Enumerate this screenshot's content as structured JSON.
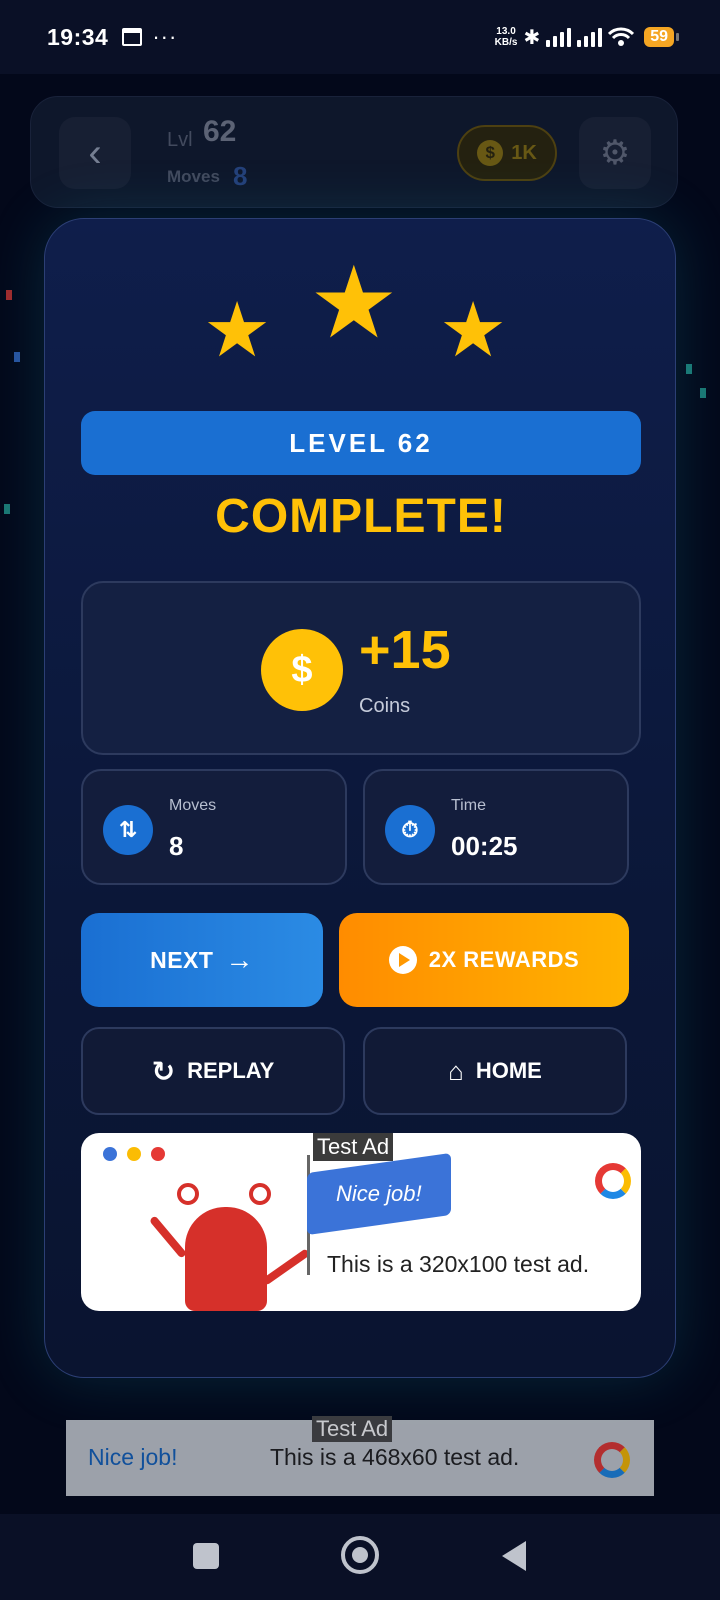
{
  "status_bar": {
    "time": "19:34",
    "more": "···",
    "net_speed_value": "13.0",
    "net_speed_unit": "KB/s",
    "battery": "59"
  },
  "top_bar": {
    "level_label": "Lvl",
    "level_number": "62",
    "moves_label": "Moves",
    "moves_number": "8",
    "coins": "1K",
    "coin_symbol": "$"
  },
  "modal": {
    "stars_earned": 3,
    "level_banner": "LEVEL 62",
    "title": "COMPLETE!",
    "reward": {
      "coin_symbol": "$",
      "amount": "+15",
      "label": "Coins"
    },
    "stats": {
      "moves_label": "Moves",
      "moves_value": "8",
      "time_label": "Time",
      "time_value": "00:25"
    },
    "buttons": {
      "next": "NEXT",
      "rewards": "2X REWARDS",
      "replay": "REPLAY",
      "home": "HOME"
    },
    "ad": {
      "tag": "Test Ad",
      "flag_text": "Nice job!",
      "text": "This is a 320x100 test ad."
    }
  },
  "bottom_ad": {
    "tag": "Test Ad",
    "left_text": "Nice job!",
    "text": "This is a 468x60 test ad."
  },
  "colors": {
    "accent_blue": "#1a6fd2",
    "gold": "#ffc107",
    "orange": "#ff8c00",
    "background": "#03081a"
  }
}
